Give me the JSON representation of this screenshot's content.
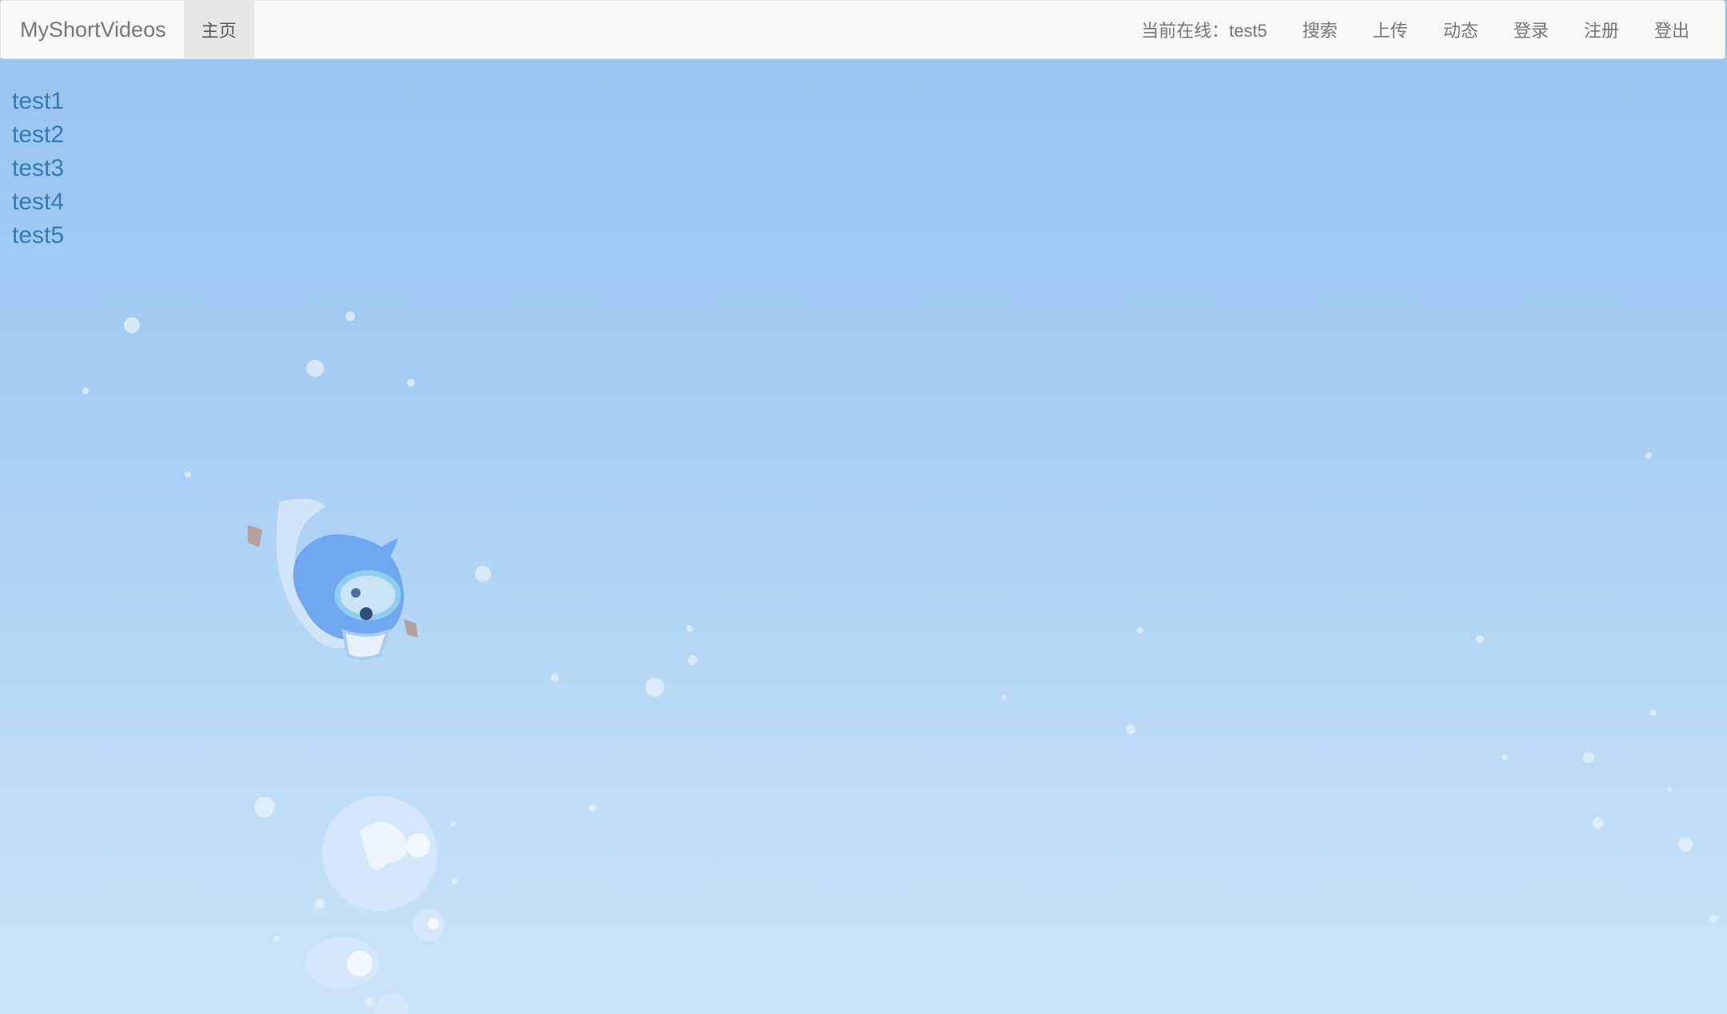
{
  "navbar": {
    "brand": "MyShortVideos",
    "home_label": "主页",
    "current_online": "当前在线：test5",
    "items": [
      {
        "label": "搜索",
        "name": "nav-search"
      },
      {
        "label": "上传",
        "name": "nav-upload"
      },
      {
        "label": "动态",
        "name": "nav-feed"
      },
      {
        "label": "登录",
        "name": "nav-login"
      },
      {
        "label": "注册",
        "name": "nav-register"
      },
      {
        "label": "登出",
        "name": "nav-logout"
      }
    ]
  },
  "users": [
    "test1",
    "test2",
    "test3",
    "test4",
    "test5"
  ],
  "colors": {
    "link": "#337ab7",
    "navbar_bg": "#f8f8f8",
    "active_bg": "#e7e7e7",
    "background_top": "#97c4f0",
    "background_bottom": "#cbe3f8"
  },
  "background": {
    "illustration": "diver-dolphin-and-bubbles"
  }
}
